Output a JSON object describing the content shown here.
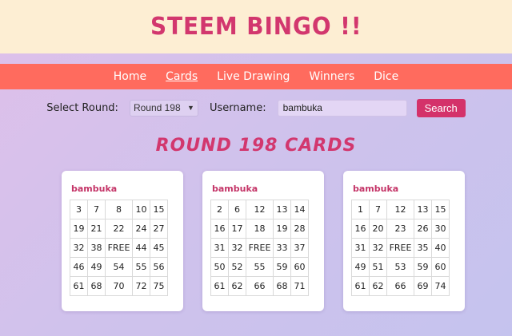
{
  "header": {
    "title": "STEEM BINGO !!"
  },
  "nav": [
    {
      "label": "Home",
      "active": false
    },
    {
      "label": "Cards",
      "active": true
    },
    {
      "label": "Live Drawing",
      "active": false
    },
    {
      "label": "Winners",
      "active": false
    },
    {
      "label": "Dice",
      "active": false
    }
  ],
  "controls": {
    "round_label": "Select Round:",
    "round_selected": "Round 198",
    "username_label": "Username:",
    "username_value": "bambuka",
    "search_label": "Search"
  },
  "round_title": "ROUND 198 CARDS",
  "colors": {
    "accent": "#d2376e",
    "nav_bg": "#ff6b5e",
    "header_bg": "#fdeed3"
  },
  "cards": [
    {
      "user": "bambuka",
      "rows": [
        [
          "3",
          "7",
          "8",
          "10",
          "15"
        ],
        [
          "19",
          "21",
          "22",
          "24",
          "27"
        ],
        [
          "32",
          "38",
          "FREE",
          "44",
          "45"
        ],
        [
          "46",
          "49",
          "54",
          "55",
          "56"
        ],
        [
          "61",
          "68",
          "70",
          "72",
          "75"
        ]
      ]
    },
    {
      "user": "bambuka",
      "rows": [
        [
          "2",
          "6",
          "12",
          "13",
          "14"
        ],
        [
          "16",
          "17",
          "18",
          "19",
          "28"
        ],
        [
          "31",
          "32",
          "FREE",
          "33",
          "37"
        ],
        [
          "50",
          "52",
          "55",
          "59",
          "60"
        ],
        [
          "61",
          "62",
          "66",
          "68",
          "71"
        ]
      ]
    },
    {
      "user": "bambuka",
      "rows": [
        [
          "1",
          "7",
          "12",
          "13",
          "15"
        ],
        [
          "16",
          "20",
          "23",
          "26",
          "30"
        ],
        [
          "31",
          "32",
          "FREE",
          "35",
          "40"
        ],
        [
          "49",
          "51",
          "53",
          "59",
          "60"
        ],
        [
          "61",
          "62",
          "66",
          "69",
          "74"
        ]
      ]
    }
  ]
}
